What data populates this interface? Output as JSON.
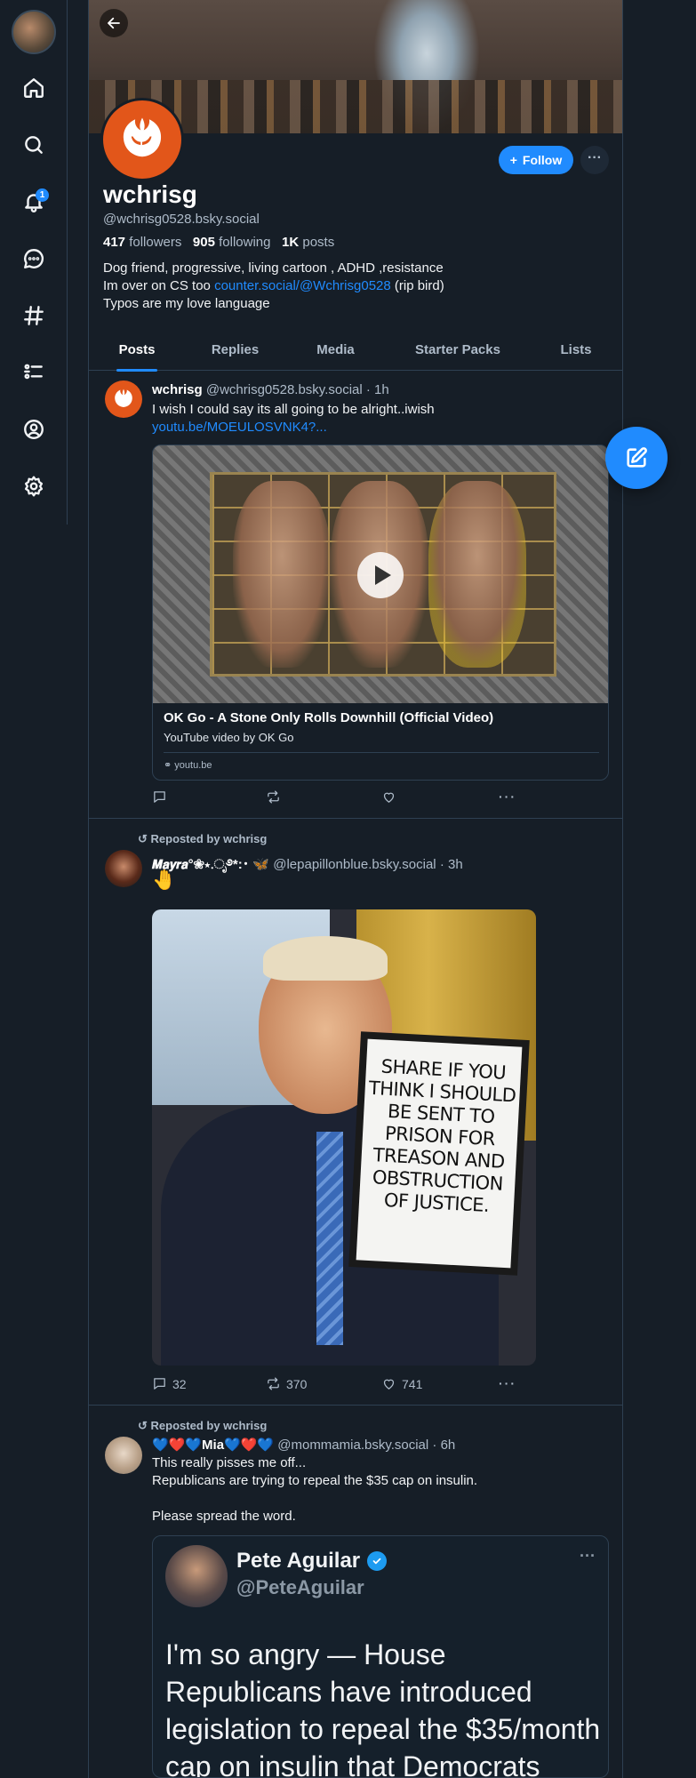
{
  "nav": {
    "notifications_badge": "1",
    "icons": [
      "home-icon",
      "search-icon",
      "bell-icon",
      "chat-icon",
      "hashtag-icon",
      "list-icon",
      "profile-icon",
      "gear-icon"
    ]
  },
  "profile": {
    "display_name": "wchrisg",
    "handle": "@wchrisg0528.bsky.social",
    "followers_count": "417",
    "followers_label": "followers",
    "following_count": "905",
    "following_label": "following",
    "posts_count": "1K",
    "posts_label": "posts",
    "bio_line1": "Dog friend, progressive, living cartoon , ADHD ,resistance",
    "bio_line2_prefix": "Im over on CS too ",
    "bio_link": "counter.social/@Wchrisg0528",
    "bio_line2_suffix": " (rip bird)",
    "bio_line3": "Typos are my love language",
    "follow_label": "Follow",
    "more_label": "···"
  },
  "tabs": [
    "Posts",
    "Replies",
    "Media",
    "Starter Packs",
    "Lists"
  ],
  "active_tab": "Posts",
  "posts": [
    {
      "author": "wchrisg",
      "handle": "@wchrisg0528.bsky.social",
      "time": "· 1h",
      "text": "I wish I could say its all going to be alright..iwish",
      "link": "youtu.be/MOEULOSVNK4?...",
      "embed": {
        "title": "OK Go - A Stone Only Rolls Downhill (Official Video)",
        "description": "YouTube video by OK Go",
        "domain": "youtu.be"
      }
    },
    {
      "repost_label": "Reposted by wchrisg",
      "author": "𝙈𝙖𝙮𝙧𝙖°❀⋆.ೃ࿔*:･ 🦋",
      "handle": "@lepapillonblue.bsky.social",
      "time": "· 3h",
      "text": "🤚",
      "image_sign_text": "SHARE IF YOU THINK I SHOULD BE SENT TO PRISON FOR TREASON AND OBSTRUCTION OF JUSTICE.",
      "replies": "32",
      "reposts": "370",
      "likes": "741"
    },
    {
      "repost_label": "Reposted by wchrisg",
      "author": "💙❤️💙Mia💙❤️💙",
      "handle": "@mommamia.bsky.social",
      "time": "· 6h",
      "text_line1": "This really pisses me off...",
      "text_line2": "Republicans are trying to repeal the $35 cap on insulin.",
      "text_line3": "Please spread the word.",
      "quote": {
        "name": "Pete Aguilar",
        "handle": "@PeteAguilar",
        "text": "I'm so angry — House Republicans have introduced legislation to repeal the $35/month cap on insulin that Democrats passed for"
      }
    }
  ],
  "colors": {
    "background": "#161e27",
    "accent": "#208bfe",
    "muted_text": "#aebbc9",
    "border": "#2e4052"
  }
}
